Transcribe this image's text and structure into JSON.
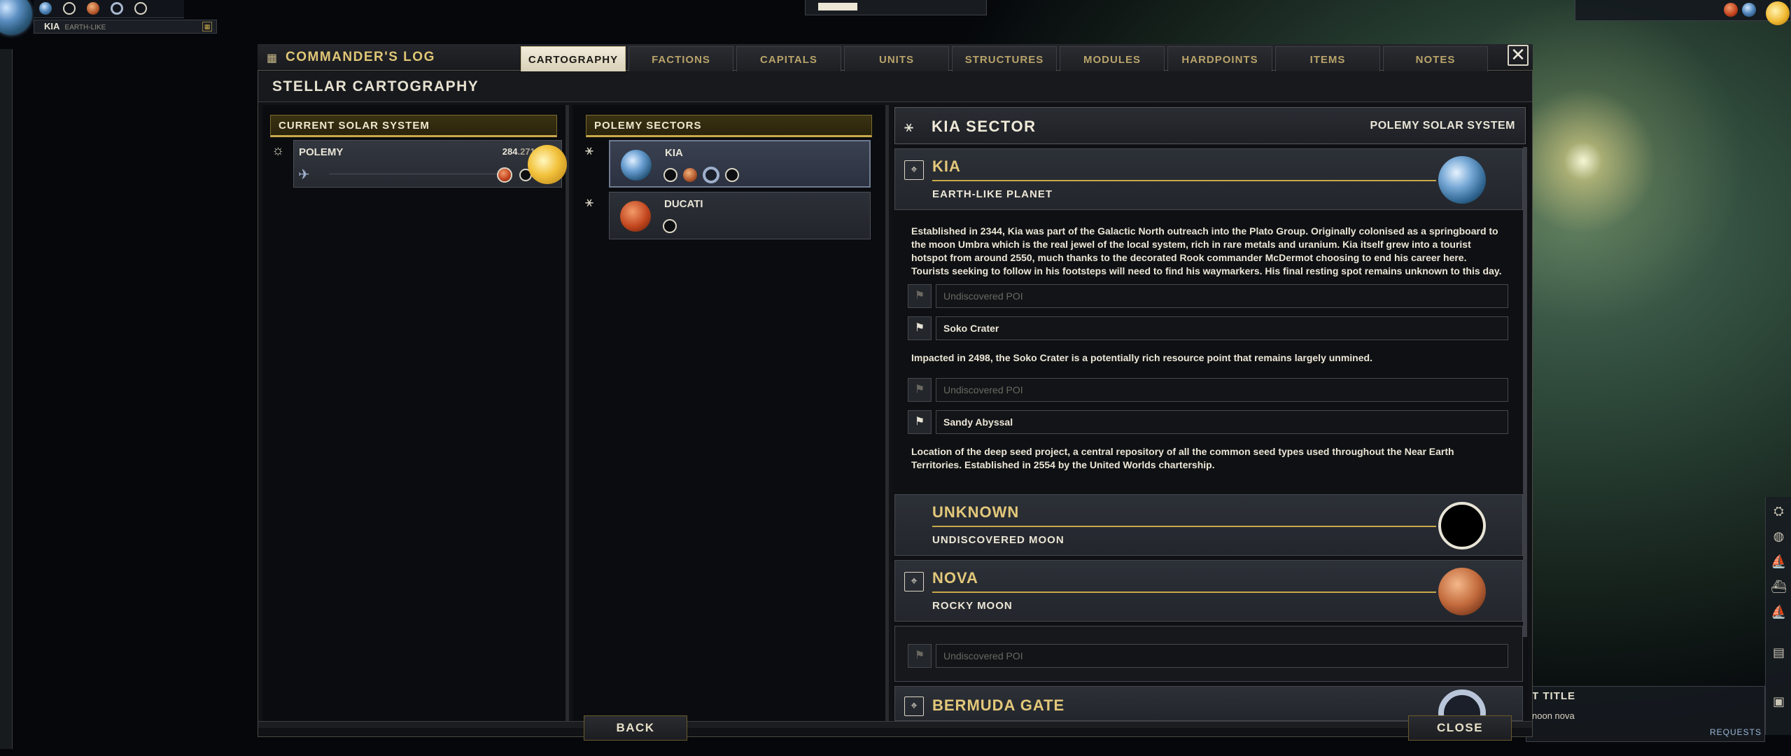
{
  "hud": {
    "planet_name": "KIA",
    "planet_type": "EARTH-LIKE"
  },
  "window": {
    "title": "COMMANDER'S LOG",
    "close": "✕",
    "section_title": "STELLAR CARTOGRAPHY"
  },
  "tabs": [
    {
      "label": "CARTOGRAPHY",
      "active": true
    },
    {
      "label": "FACTIONS"
    },
    {
      "label": "CAPITALS"
    },
    {
      "label": "UNITS"
    },
    {
      "label": "STRUCTURES"
    },
    {
      "label": "MODULES"
    },
    {
      "label": "HARDPOINTS"
    },
    {
      "label": "ITEMS"
    },
    {
      "label": "NOTES"
    }
  ],
  "current_system": {
    "header": "CURRENT SOLAR SYSTEM",
    "name": "POLEMY",
    "value_int": "284",
    "value_dec": ".2713"
  },
  "sectors": {
    "header": "POLEMY SECTORS",
    "items": [
      {
        "name": "KIA",
        "selected": true
      },
      {
        "name": "DUCATI",
        "selected": false
      }
    ]
  },
  "detail": {
    "title": "KIA SECTOR",
    "system": "POLEMY SOLAR SYSTEM",
    "bodies": [
      {
        "name": "KIA",
        "type": "EARTH-LIKE PLANET",
        "description": "Established in 2344, Kia was part of the Galactic North outreach into the Plato Group. Originally colonised as a springboard to the moon Umbra which is the real jewel of the local system, rich in rare metals and uranium. Kia itself grew into a tourist hotspot from around 2550, much thanks to the decorated Rook commander McDermot choosing to end his career here. Tourists seeking to follow in his footsteps will need to find his waymarkers. His final resting spot remains unknown to this day.",
        "pois": [
          {
            "label": "Undiscovered POI",
            "discovered": false
          },
          {
            "label": "Soko Crater",
            "discovered": true,
            "description": "Impacted in 2498, the Soko Crater is a potentially rich resource point that remains largely unmined."
          },
          {
            "label": "Undiscovered POI",
            "discovered": false
          },
          {
            "label": "Sandy Abyssal",
            "discovered": true,
            "description": "Location of the deep seed project, a central repository of all the common seed types used throughout the Near Earth Territories. Established in 2554 by the United Worlds chartership."
          }
        ]
      },
      {
        "name": "UNKNOWN",
        "type": "UNDISCOVERED MOON"
      },
      {
        "name": "NOVA",
        "type": "ROCKY MOON",
        "pois": [
          {
            "label": "Undiscovered POI",
            "discovered": false
          }
        ]
      },
      {
        "name": "BERMUDA GATE",
        "type": ""
      }
    ]
  },
  "footer": {
    "back": "BACK",
    "close": "CLOSE"
  },
  "corner_widget": {
    "title": "T TITLE",
    "text": "noon nova",
    "requests": "REQUESTS"
  },
  "colors": {
    "accent_gold": "#c9a94a",
    "title_gold": "#e0c676",
    "panel_bg": "#23262c"
  }
}
